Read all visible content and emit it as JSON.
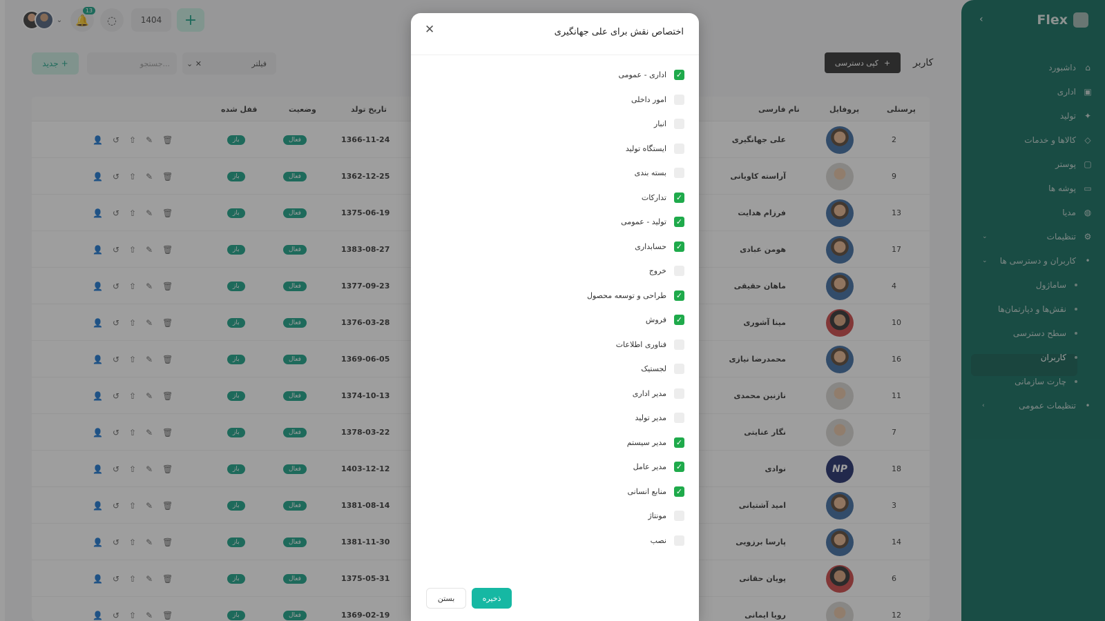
{
  "topbar": {
    "notification_count": "13",
    "year": "1404",
    "add_icon": "plus-icon"
  },
  "toolbar": {
    "new_label": "جدید",
    "search_placeholder": "جستجو...",
    "filter_label": "فیلتر",
    "copy_access_label": "کپی دسترسی",
    "page_label": "کاربر"
  },
  "table": {
    "headers": {
      "personnel": "پرسنلی",
      "profile": "پروفایل",
      "name": "نام فارسی",
      "birth": "تاریخ تولد",
      "status": "وضعیت",
      "locked": "قفل شده"
    },
    "rows": [
      {
        "id": "2",
        "name": "علی جهانگیری",
        "birth": "1366-11-24",
        "status": "فعال",
        "locked": "باز"
      },
      {
        "id": "9",
        "name": "آراسته کاویانی",
        "birth": "1362-12-25",
        "status": "فعال",
        "locked": "باز"
      },
      {
        "id": "13",
        "name": "فرزام هدایت",
        "birth": "1375-06-19",
        "status": "فعال",
        "locked": "باز"
      },
      {
        "id": "17",
        "name": "هومن عبادی",
        "birth": "1383-08-27",
        "status": "فعال",
        "locked": "باز"
      },
      {
        "id": "4",
        "name": "ماهان حقیقی",
        "birth": "1377-09-23",
        "status": "فعال",
        "locked": "باز"
      },
      {
        "id": "10",
        "name": "مینا آشوری",
        "birth": "1376-03-28",
        "status": "فعال",
        "locked": "باز"
      },
      {
        "id": "16",
        "name": "محمدرضا نیازی",
        "birth": "1369-06-05",
        "status": "فعال",
        "locked": "باز"
      },
      {
        "id": "11",
        "name": "نازنین محمدی",
        "birth": "1374-10-13",
        "status": "فعال",
        "locked": "باز"
      },
      {
        "id": "7",
        "name": "نگار عنایتی",
        "birth": "1378-03-22",
        "status": "فعال",
        "locked": "باز"
      },
      {
        "id": "18",
        "name": "نوادی",
        "birth": "1403-12-12",
        "status": "فعال",
        "locked": "باز"
      },
      {
        "id": "3",
        "name": "امید آشتیانی",
        "birth": "1381-08-14",
        "status": "فعال",
        "locked": "باز"
      },
      {
        "id": "14",
        "name": "پارسا برزویی",
        "birth": "1381-11-30",
        "status": "فعال",
        "locked": "باز"
      },
      {
        "id": "6",
        "name": "پویان حقانی",
        "birth": "1375-05-31",
        "status": "فعال",
        "locked": "باز"
      },
      {
        "id": "12",
        "name": "رویا ایمانی",
        "birth": "1369-02-19",
        "status": "فعال",
        "locked": "باز"
      }
    ]
  },
  "sidebar": {
    "brand": "Flex",
    "items": [
      {
        "label": "داشبورد",
        "icon": "home-icon"
      },
      {
        "label": "اداری",
        "icon": "briefcase-icon"
      },
      {
        "label": "تولید",
        "icon": "gear-icon"
      },
      {
        "label": "کالاها و خدمات",
        "icon": "box-icon"
      },
      {
        "label": "پوستر",
        "icon": "image-icon"
      },
      {
        "label": "پوشه ها",
        "icon": "folder-icon"
      },
      {
        "label": "مدیا",
        "icon": "media-icon"
      },
      {
        "label": "تنظیمات",
        "icon": "settings-icon"
      }
    ],
    "users_access": "کاربران و دسترسی ها",
    "sub_items": [
      "ساماژول",
      "نقش‌ها و دپارتمان‌ها",
      "سطح دسترسی",
      "کاربران",
      "چارت سازمانی"
    ],
    "general_settings": "تنظیمات عمومی"
  },
  "modal": {
    "title": "اختصاص نقش برای علی جهانگیری",
    "save_label": "ذخیره",
    "close_label": "بستن",
    "roles": [
      {
        "label": "اداری - عمومی",
        "checked": true
      },
      {
        "label": "امور داخلی",
        "checked": false
      },
      {
        "label": "انبار",
        "checked": false
      },
      {
        "label": "ایستگاه تولید",
        "checked": false
      },
      {
        "label": "بسته بندی",
        "checked": false
      },
      {
        "label": "تدارکات",
        "checked": true
      },
      {
        "label": "تولید - عمومی",
        "checked": true
      },
      {
        "label": "حسابداری",
        "checked": true
      },
      {
        "label": "خروج",
        "checked": false
      },
      {
        "label": "طراحی و توسعه محصول",
        "checked": true
      },
      {
        "label": "فروش",
        "checked": true
      },
      {
        "label": "فناوری اطلاعات",
        "checked": false
      },
      {
        "label": "لجستیک",
        "checked": false
      },
      {
        "label": "مدیر اداری",
        "checked": false
      },
      {
        "label": "مدیر تولید",
        "checked": false
      },
      {
        "label": "مدیر سیستم",
        "checked": true
      },
      {
        "label": "مدیر عامل",
        "checked": true
      },
      {
        "label": "منابع انسانی",
        "checked": true
      },
      {
        "label": "مونتاژ",
        "checked": false
      },
      {
        "label": "نصب",
        "checked": false
      }
    ]
  }
}
